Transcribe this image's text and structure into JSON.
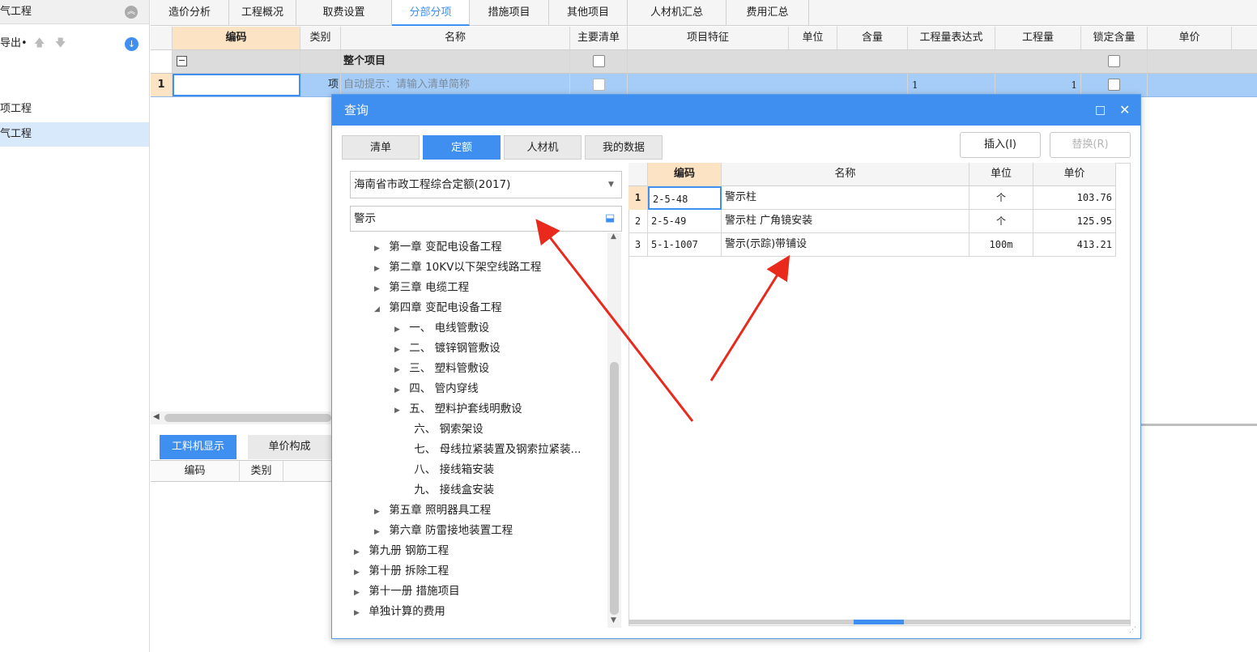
{
  "left": {
    "title": "气工程",
    "export_label": "导出•",
    "items": [
      "项工程",
      "气工程"
    ]
  },
  "tabs": [
    "造价分析",
    "工程概况",
    "取费设置",
    "分部分项",
    "措施项目",
    "其他项目",
    "人材机汇总",
    "费用汇总"
  ],
  "grid": {
    "headers": [
      "编码",
      "类别",
      "名称",
      "主要清单",
      "项目特征",
      "单位",
      "含量",
      "工程量表达式",
      "工程量",
      "锁定含量",
      "单价"
    ],
    "whole_row_label": "整个项目",
    "row1": {
      "num": "1",
      "type": "项",
      "name_hint": "自动提示：请输入清单简称",
      "expr": "1",
      "qty": "1"
    }
  },
  "bottom": {
    "tabs": [
      "工料机显示",
      "单价构成"
    ],
    "headers": [
      "编码",
      "类别"
    ]
  },
  "dialog": {
    "title": "查询",
    "tabs": [
      "清单",
      "定额",
      "人材机",
      "我的数据"
    ],
    "insert_label": "插入(I)",
    "replace_label": "替换(R)",
    "quota_library": "海南省市政工程综合定额(2017)",
    "search_value": "警示",
    "tree": [
      {
        "label": "第一章 变配电设备工程",
        "icon": "collapsed"
      },
      {
        "label": "第二章 10KV以下架空线路工程",
        "icon": "collapsed"
      },
      {
        "label": "第三章 电缆工程",
        "icon": "collapsed"
      },
      {
        "label": "第四章 变配电设备工程",
        "icon": "expanded"
      },
      {
        "label": "一、 电线管敷设",
        "icon": "collapsed"
      },
      {
        "label": "二、 镀锌钢管敷设",
        "icon": "collapsed"
      },
      {
        "label": "三、 塑料管敷设",
        "icon": "collapsed"
      },
      {
        "label": "四、 管内穿线",
        "icon": "collapsed"
      },
      {
        "label": "五、 塑料护套线明敷设",
        "icon": "collapsed"
      },
      {
        "label": "六、 钢索架设",
        "icon": "none"
      },
      {
        "label": "七、 母线拉紧装置及钢索拉紧装...",
        "icon": "none"
      },
      {
        "label": "八、 接线箱安装",
        "icon": "none"
      },
      {
        "label": "九、 接线盒安装",
        "icon": "none"
      },
      {
        "label": "第五章 照明器具工程",
        "icon": "collapsed"
      },
      {
        "label": "第六章 防雷接地装置工程",
        "icon": "collapsed"
      },
      {
        "label": "第九册 钢筋工程",
        "icon": "collapsed"
      },
      {
        "label": "第十册 拆除工程",
        "icon": "collapsed"
      },
      {
        "label": "第十一册 措施项目",
        "icon": "collapsed"
      },
      {
        "label": "单独计算的费用",
        "icon": "collapsed"
      }
    ],
    "result_headers": [
      "编码",
      "名称",
      "单位",
      "单价"
    ],
    "results": [
      {
        "num": "1",
        "code": "2-5-48",
        "name": "警示柱",
        "unit": "个",
        "price": "103.76"
      },
      {
        "num": "2",
        "code": "2-5-49",
        "name": "警示柱 广角镜安装",
        "unit": "个",
        "price": "125.95"
      },
      {
        "num": "3",
        "code": "5-1-1007",
        "name": "警示(示踪)带铺设",
        "unit": "100m",
        "price": "413.21"
      }
    ]
  },
  "colors": {
    "accent": "#3f8ff0",
    "arrow": "#e8291c",
    "header_bg": "#fbe3c3",
    "selected_row": "#a6cdf7"
  }
}
